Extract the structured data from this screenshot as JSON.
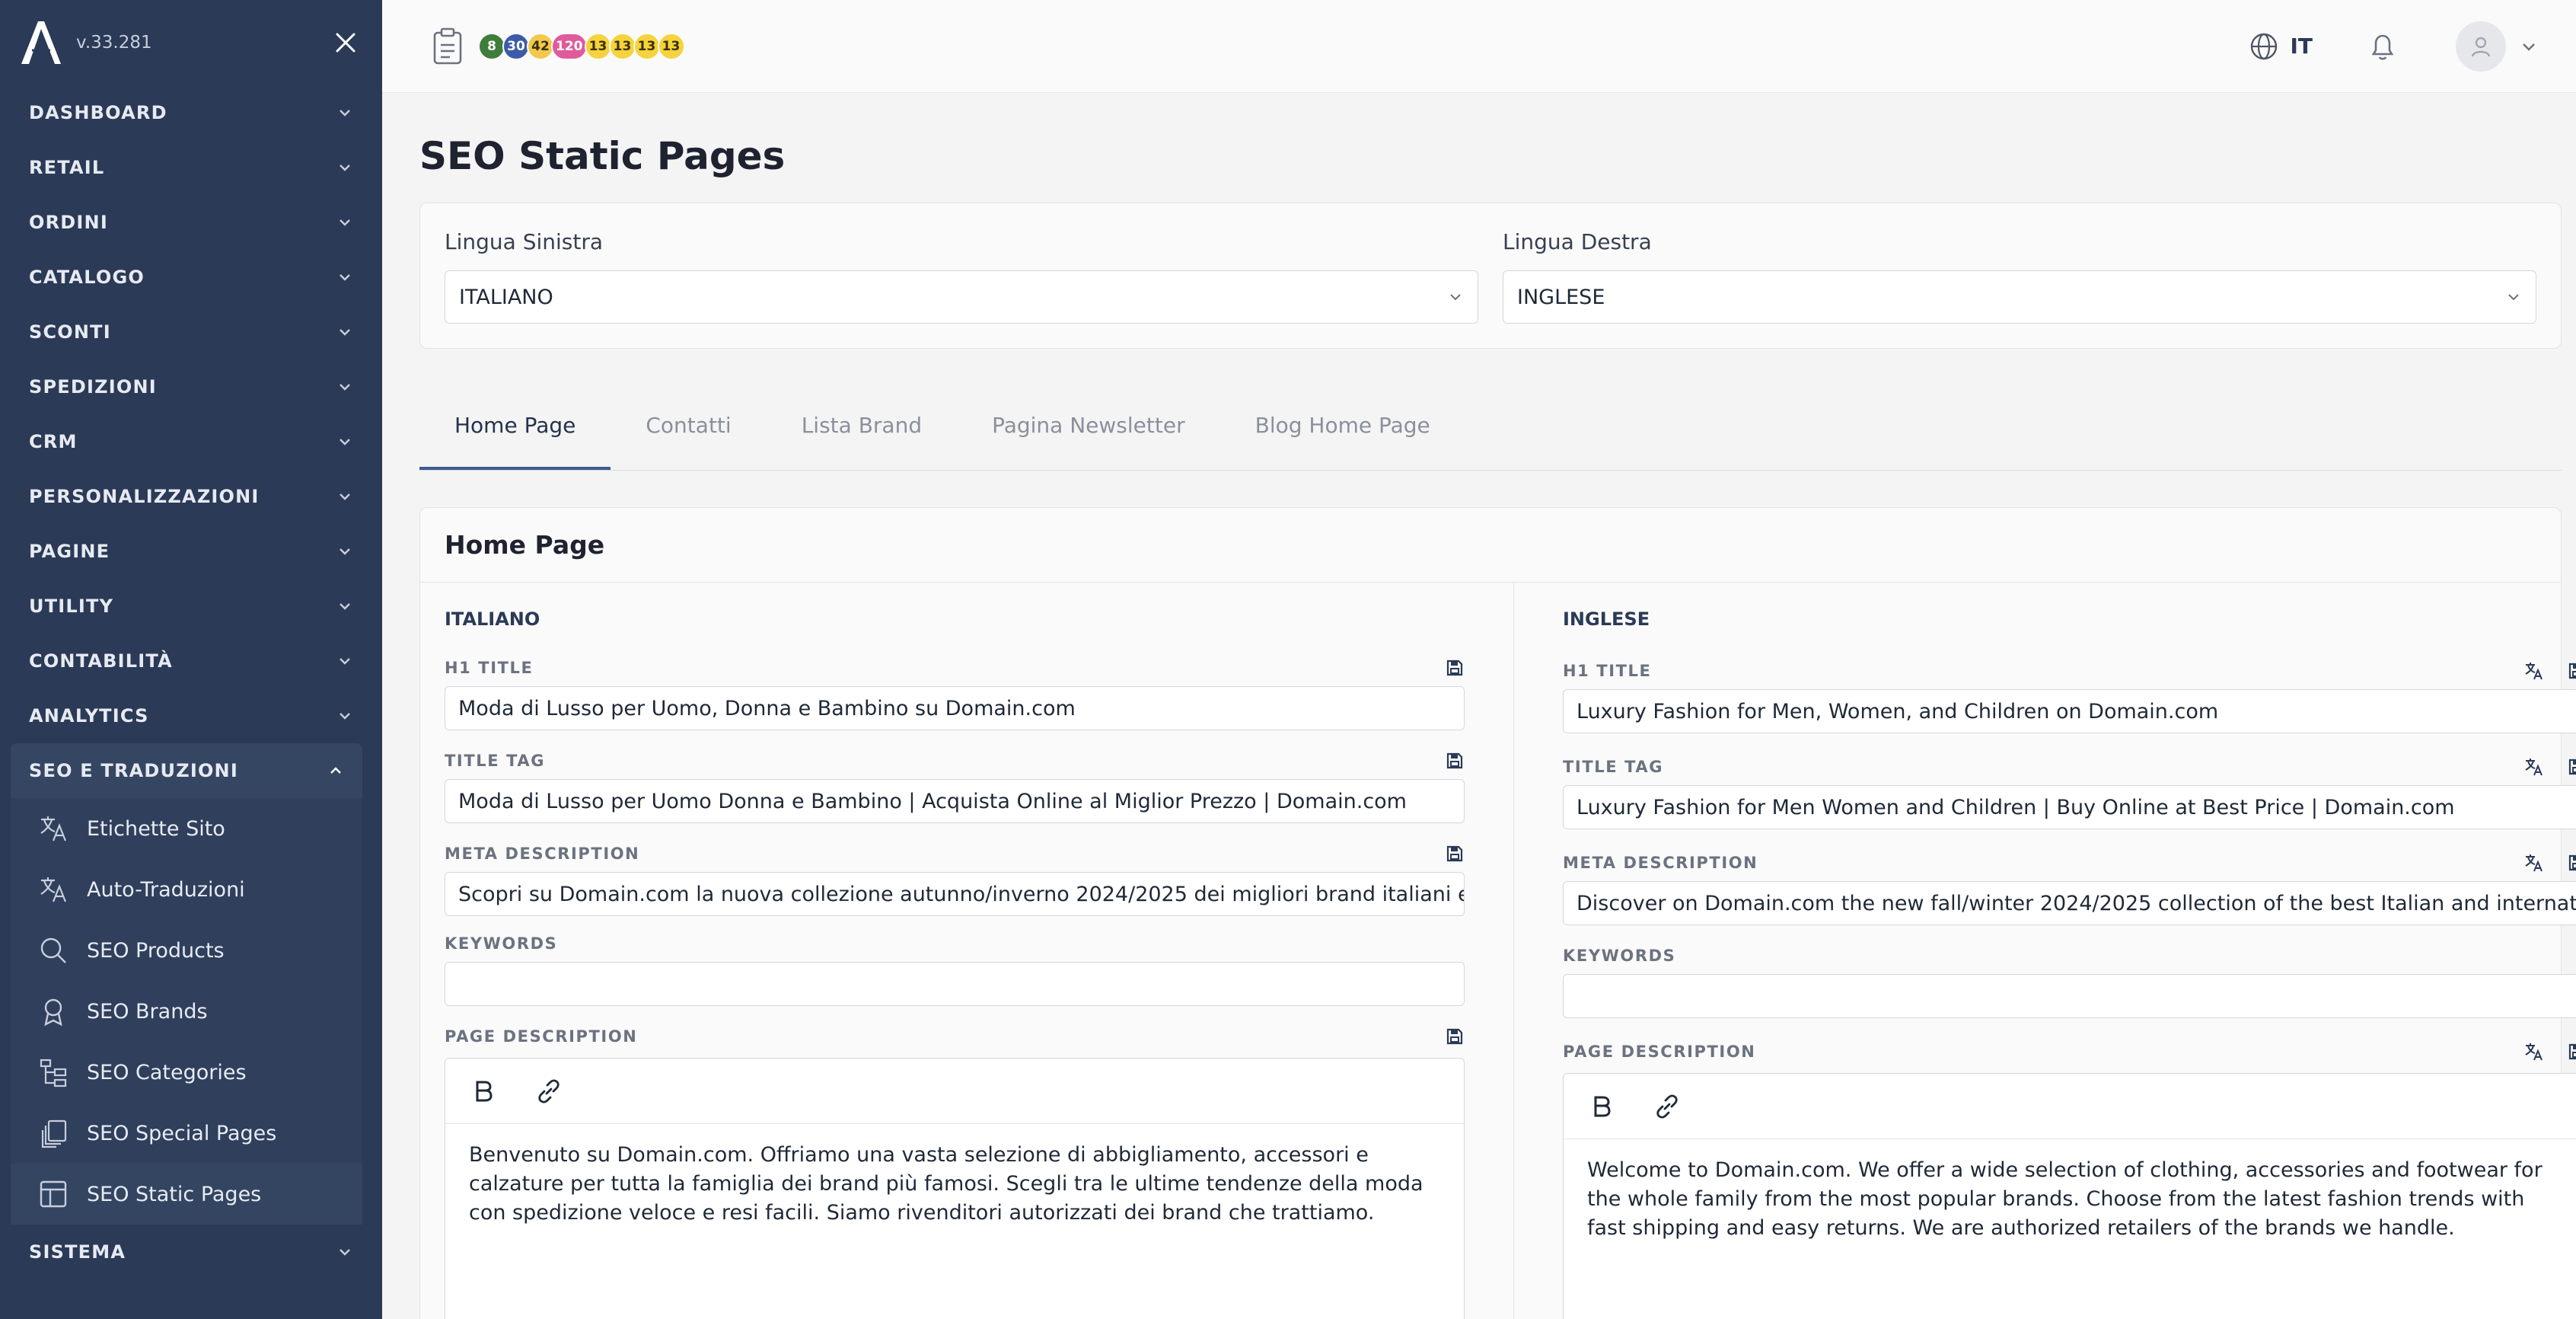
{
  "app": {
    "version": "v.33.281",
    "logo_letter": "A"
  },
  "sidebar": {
    "menu": [
      {
        "label": "DASHBOARD"
      },
      {
        "label": "RETAIL"
      },
      {
        "label": "ORDINI"
      },
      {
        "label": "CATALOGO"
      },
      {
        "label": "SCONTI"
      },
      {
        "label": "SPEDIZIONI"
      },
      {
        "label": "CRM"
      },
      {
        "label": "PERSONALIZZAZIONI"
      },
      {
        "label": "PAGINE"
      },
      {
        "label": "UTILITY"
      },
      {
        "label": "CONTABILITÀ"
      },
      {
        "label": "ANALYTICS"
      }
    ],
    "active_section": "SEO E TRADUZIONI",
    "submenu": [
      {
        "label": "Etichette Sito",
        "icon": "translate-icon"
      },
      {
        "label": "Auto-Traduzioni",
        "icon": "translate-icon"
      },
      {
        "label": "SEO Products",
        "icon": "search-icon"
      },
      {
        "label": "SEO Brands",
        "icon": "award-icon"
      },
      {
        "label": "SEO Categories",
        "icon": "hierarchy-icon"
      },
      {
        "label": "SEO Special Pages",
        "icon": "stack-icon"
      },
      {
        "label": "SEO Static Pages",
        "icon": "layout-icon"
      }
    ],
    "after": [
      {
        "label": "SISTEMA"
      }
    ]
  },
  "topbar": {
    "badges": [
      {
        "value": "8",
        "color": "#3f7d3a"
      },
      {
        "value": "30",
        "color": "#3b5ba9"
      },
      {
        "value": "42",
        "color": "#f2c94c"
      },
      {
        "value": "120",
        "color": "#e05a9c"
      },
      {
        "value": "13",
        "color": "#f5d33c"
      },
      {
        "value": "13",
        "color": "#f5d33c"
      },
      {
        "value": "13",
        "color": "#f5d33c"
      },
      {
        "value": "13",
        "color": "#f5d33c"
      }
    ],
    "language": "IT"
  },
  "page": {
    "title": "SEO Static Pages",
    "left_language_label": "Lingua Sinistra",
    "left_language_value": "ITALIANO",
    "right_language_label": "Lingua Destra",
    "right_language_value": "INGLESE"
  },
  "tabs": [
    {
      "label": "Home Page"
    },
    {
      "label": "Contatti"
    },
    {
      "label": "Lista Brand"
    },
    {
      "label": "Pagina Newsletter"
    },
    {
      "label": "Blog Home Page"
    }
  ],
  "content": {
    "title": "Home Page",
    "left": {
      "language": "ITALIANO",
      "h1_label": "H1 TITLE",
      "h1_value": "Moda di Lusso per Uomo, Donna e Bambino su Domain.com",
      "title_tag_label": "TITLE TAG",
      "title_tag_value": "Moda di Lusso per Uomo Donna e Bambino | Acquista Online al Miglior Prezzo |  Domain.com",
      "meta_label": "META DESCRIPTION",
      "meta_value": "Scopri su  Domain.com la nuova collezione autunno/inverno 2024/2025 dei migliori brand italiani e internazionali",
      "keywords_label": "KEYWORDS",
      "keywords_value": "",
      "page_desc_label": "PAGE DESCRIPTION",
      "page_desc_value": "Benvenuto su  Domain.com. Offriamo una vasta selezione di abbigliamento, accessori e calzature per tutta la famiglia dei brand più famosi. Scegli tra le ultime tendenze della moda con spedizione veloce e resi facili. Siamo rivenditori autorizzati dei brand che trattiamo."
    },
    "right": {
      "language": "INGLESE",
      "h1_label": "H1 TITLE",
      "h1_value": "Luxury Fashion for Men, Women, and Children on  Domain.com",
      "title_tag_label": "TITLE TAG",
      "title_tag_value": "Luxury Fashion for Men Women and Children | Buy Online at Best Price |  Domain.com",
      "meta_label": "META DESCRIPTION",
      "meta_value": "Discover on  Domain.com the new fall/winter 2024/2025 collection of the best Italian and international brands",
      "keywords_label": "KEYWORDS",
      "keywords_value": "",
      "page_desc_label": "PAGE DESCRIPTION",
      "page_desc_value": "Welcome to  Domain.com. We offer a wide selection of clothing, accessories and footwear for the whole family from the most popular brands. Choose from the latest fashion trends with fast shipping and easy returns. We are authorized retailers of the brands we handle."
    }
  }
}
